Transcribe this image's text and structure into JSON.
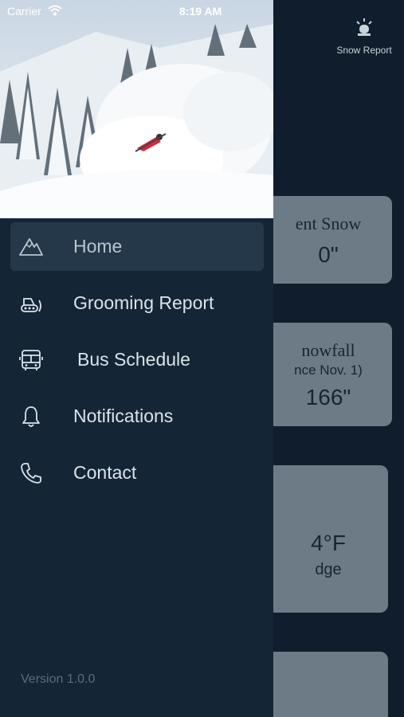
{
  "status_bar": {
    "carrier": "Carrier",
    "time": "8:19 AM"
  },
  "header": {
    "snow_report_label": "Snow Report"
  },
  "cards": [
    {
      "title": "ent Snow",
      "value": "0\""
    },
    {
      "title": "nowfall",
      "subtitle": "nce Nov. 1)",
      "value": "166\""
    },
    {
      "value": "4°F",
      "subtitle": "dge"
    }
  ],
  "drawer": {
    "menu": [
      {
        "label": "Home",
        "icon": "mountain-icon",
        "active": true
      },
      {
        "label": "Grooming Report",
        "icon": "snowcat-icon",
        "active": false
      },
      {
        "label": "Bus Schedule",
        "icon": "bus-icon",
        "active": false
      },
      {
        "label": "Notifications",
        "icon": "bell-icon",
        "active": false
      },
      {
        "label": "Contact",
        "icon": "phone-icon",
        "active": false
      }
    ],
    "version": "Version 1.0.0"
  },
  "colors": {
    "drawer_bg": "#142536",
    "active_item_bg": "#253849",
    "card_bg": "#6d7b86",
    "app_bg": "#0f1d2c"
  }
}
